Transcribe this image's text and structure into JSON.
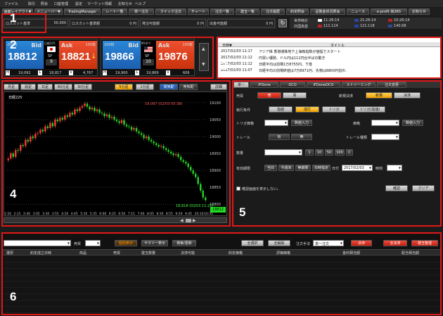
{
  "menu": [
    "ファイル",
    "取引",
    "照会",
    "口座管理",
    "設定",
    "マーケット情報",
    "お知らせ",
    "ヘルプ"
  ],
  "toolbar": [
    "画面レイアウト▼",
    "メニューバー▼",
    "TradingManager",
    "レート一覧",
    "単一注文",
    "クイック注文",
    "チャート",
    "注文一覧",
    "建玉一覧",
    "注文履歴",
    "約定照会",
    "証拠金状況照会",
    "ニュース",
    "e-profit 株365",
    "お知らせ"
  ],
  "account": {
    "cells": [
      {
        "label": "ロスカット基準",
        "value": "50,000"
      },
      {
        "label": "ロスカット基準額",
        "value": "0 円"
      },
      {
        "label": "発注可能額",
        "value": "0 円"
      },
      {
        "label": "出金可能額",
        "value": "0 円"
      }
    ],
    "time_labels": [
      "世界時計",
      "外国為替"
    ],
    "clocks": [
      "11:26:14",
      "21:26:14",
      "10:26:14",
      "111.114",
      "121.118",
      "140.68"
    ]
  },
  "markers": [
    "1",
    "2",
    "3",
    "4",
    "5",
    "6"
  ],
  "quotes": [
    {
      "label": "日経225",
      "bid_label": "Bid",
      "ask_label": "Ask",
      "bid": "18812",
      "ask": "18821",
      "sp_label": "SP",
      "sp": "9",
      "bid_size": "200枚",
      "ask_size": "100枚",
      "h": "19,092",
      "l": "18,817",
      "v": "4,767",
      "flag": "japan"
    },
    {
      "label": "NYダウ",
      "bid_label": "Bid",
      "ask_label": "Ask",
      "bid": "19866",
      "ask": "19876",
      "sp_label": "SP",
      "sp": "10",
      "bid_size": "200枚",
      "ask_size": "100枚",
      "h": "19,900",
      "l": "19,869",
      "v": "606",
      "flag": "us"
    }
  ],
  "news": {
    "headers": [
      "日時▼",
      "タイトル"
    ],
    "rows": [
      {
        "date": "2017/02/03 11:17",
        "title": "アジア株 香港通株地下上海株指数が値幅でスタート"
      },
      {
        "date": "2017/02/03 11:12",
        "title": "円買い優勢、ドル円は111円台半ばの動き"
      },
      {
        "date": "2017/02/03 11:12",
        "title": "日経平均は前場1万8755円、下落"
      },
      {
        "date": "2017/02/03 11:07",
        "title": "日経平均の前場終値は7万8971円、先物は8800円割れ"
      }
    ]
  },
  "chart": {
    "tabs": [
      "月足",
      "週足",
      "日足",
      "60分足",
      "30分足",
      "5分足",
      "1分足",
      "買気配",
      "売気配",
      "詳細"
    ],
    "legend": "日経225",
    "chart_data": {
      "type": "bar",
      "title": "日経225",
      "x_ticks": [
        "1:50",
        "2:15",
        "2:40",
        "3:05",
        "3:30",
        "3:55",
        "4:20",
        "4:45",
        "5:10",
        "5:35",
        "6:00",
        "6:25",
        "6:50",
        "7:15",
        "7:40",
        "8:05",
        "8:30",
        "8:55",
        "9:20",
        "9:45",
        "10:10",
        "10:35"
      ],
      "y_ticks": [
        "19100",
        "19050",
        "19000",
        "18950",
        "18900",
        "18850",
        "18800"
      ],
      "ylim": [
        18790,
        19110
      ],
      "max_label": "19,097 (02/03 05:38)",
      "min_label": "18,818 (02/03 11:25)",
      "last": "18812",
      "candles": [
        18935,
        18950,
        18940,
        18960,
        18958,
        18975,
        18972,
        18990,
        18985,
        19000,
        18995,
        19008,
        19010,
        19020,
        19015,
        19030,
        19025,
        19040,
        19030,
        19050,
        19045,
        19055,
        19050,
        19062,
        19058,
        19070,
        19065,
        19080,
        19075,
        19085,
        19090,
        19097,
        19088,
        19080,
        19085,
        19075,
        19080,
        19070,
        19068,
        19060,
        19065,
        19055,
        19058,
        19050,
        19045,
        19040,
        19048,
        19035,
        19030,
        19028,
        19020,
        19025,
        19015,
        19010,
        19005,
        18995,
        19000,
        18990,
        18985,
        18980,
        18975,
        18970,
        18972,
        18965,
        18960,
        18955,
        18950,
        18945,
        18948,
        18940,
        18930,
        18925,
        18920,
        18910,
        18900,
        18890,
        18880,
        18860,
        18840,
        18820,
        18812
      ]
    }
  },
  "order": {
    "tabs": [
      "単一",
      "IFDone",
      "OCO",
      "IFDoneOCO",
      "ストリーミング",
      "注文変更"
    ],
    "labels": [
      "売買",
      "執行条件",
      "トリガ価格",
      "トレール",
      "数量",
      "有効期限",
      "新規決済",
      "価格",
      "トレール種類"
    ],
    "sell": "売",
    "buy": "買",
    "new": "新規",
    "settle": "決済",
    "exec": [
      "指値",
      "成行",
      "トリガ",
      "トリガ(指値)"
    ],
    "on": "有",
    "off": "無",
    "qty_steps": [
      "1",
      "10",
      "50",
      "100"
    ],
    "expiry": [
      "当日",
      "今週末",
      "無期限",
      "日時指定"
    ],
    "date_label": "日付",
    "date": "2017/02/03",
    "time_label": "時刻",
    "confirm_check": "確認画面を表示しない。",
    "confirm_btn": "確認",
    "clear_btn": "クリア",
    "spin_label": "数値入力"
  },
  "positions": {
    "side_label": "売買",
    "buttons": [
      "個別表示",
      "サマリー表示",
      "検索/更新"
    ],
    "right_buttons": [
      "全選択",
      "全解除"
    ],
    "order_method_label": "注文手法",
    "order_method": "単一注文",
    "action_buttons": [
      "決済",
      "全決済",
      "建玉整理"
    ],
    "headers": [
      "選択",
      "約定成立日時",
      "商品",
      "売買",
      "建玉数量",
      "決済可能",
      "約定価格",
      "評価価格",
      "金利相当額",
      "配当相当額"
    ]
  }
}
